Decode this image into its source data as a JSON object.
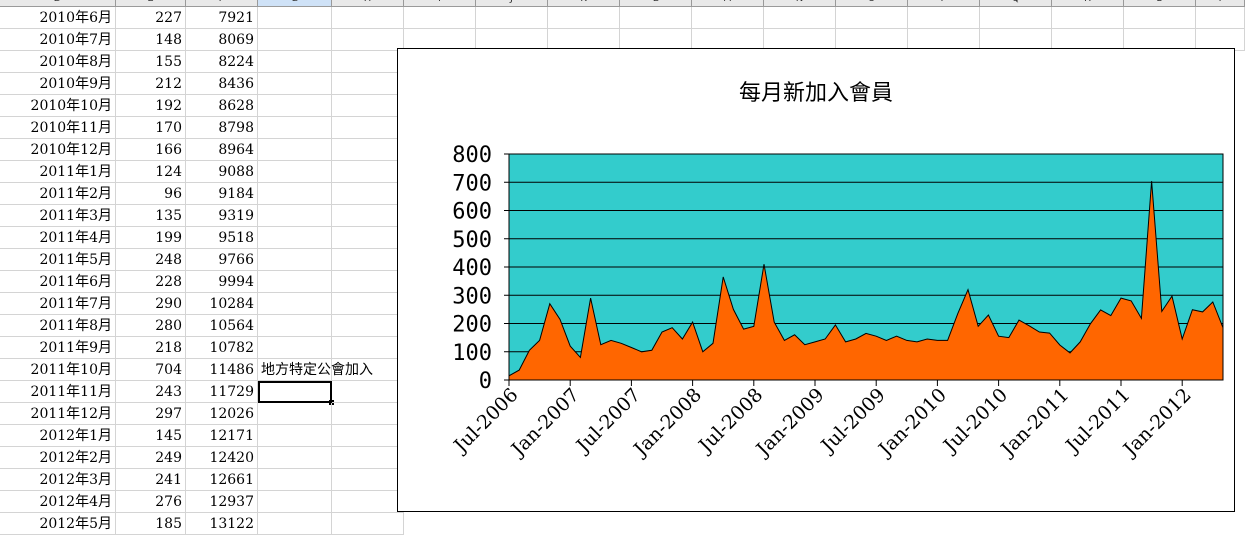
{
  "columns": [
    "D",
    "E",
    "F",
    "G",
    "H",
    "I",
    "J",
    "K",
    "L",
    "M",
    "N",
    "O",
    "P",
    "Q",
    "R",
    "S",
    "T"
  ],
  "rows": [
    {
      "date": "2010年6月",
      "count": "227",
      "total": "7921"
    },
    {
      "date": "2010年7月",
      "count": "148",
      "total": "8069"
    },
    {
      "date": "2010年8月",
      "count": "155",
      "total": "8224"
    },
    {
      "date": "2010年9月",
      "count": "212",
      "total": "8436"
    },
    {
      "date": "2010年10月",
      "count": "192",
      "total": "8628"
    },
    {
      "date": "2010年11月",
      "count": "170",
      "total": "8798"
    },
    {
      "date": "2010年12月",
      "count": "166",
      "total": "8964"
    },
    {
      "date": "2011年1月",
      "count": "124",
      "total": "9088"
    },
    {
      "date": "2011年2月",
      "count": "96",
      "total": "9184"
    },
    {
      "date": "2011年3月",
      "count": "135",
      "total": "9319"
    },
    {
      "date": "2011年4月",
      "count": "199",
      "total": "9518"
    },
    {
      "date": "2011年5月",
      "count": "248",
      "total": "9766"
    },
    {
      "date": "2011年6月",
      "count": "228",
      "total": "9994"
    },
    {
      "date": "2011年7月",
      "count": "290",
      "total": "10284"
    },
    {
      "date": "2011年8月",
      "count": "280",
      "total": "10564"
    },
    {
      "date": "2011年9月",
      "count": "218",
      "total": "10782"
    },
    {
      "date": "2011年10月",
      "count": "704",
      "total": "11486",
      "note": "地方特定公會加入"
    },
    {
      "date": "2011年11月",
      "count": "243",
      "total": "11729"
    },
    {
      "date": "2011年12月",
      "count": "297",
      "total": "12026"
    },
    {
      "date": "2012年1月",
      "count": "145",
      "total": "12171"
    },
    {
      "date": "2012年2月",
      "count": "249",
      "total": "12420"
    },
    {
      "date": "2012年3月",
      "count": "241",
      "total": "12661"
    },
    {
      "date": "2012年4月",
      "count": "276",
      "total": "12937"
    },
    {
      "date": "2012年5月",
      "count": "185",
      "total": "13122"
    }
  ],
  "colors": {
    "plot_bg": "#33cccc",
    "area": "#ff6600",
    "grid": "#000000"
  },
  "chart_data": {
    "type": "area",
    "title": "每月新加入會員",
    "xlabel": "",
    "ylabel": "",
    "ylim": [
      0,
      800
    ],
    "yticks": [
      0,
      100,
      200,
      300,
      400,
      500,
      600,
      700,
      800
    ],
    "xtick_labels": [
      "Jul-2006",
      "Jan-2007",
      "Jul-2007",
      "Jan-2008",
      "Jul-2008",
      "Jan-2009",
      "Jul-2009",
      "Jan-2010",
      "Jul-2010",
      "Jan-2011",
      "Jul-2011",
      "Jan-2012"
    ],
    "grid": true,
    "legend": "none",
    "x": [
      "2006-07",
      "2006-08",
      "2006-09",
      "2006-10",
      "2006-11",
      "2006-12",
      "2007-01",
      "2007-02",
      "2007-03",
      "2007-04",
      "2007-05",
      "2007-06",
      "2007-07",
      "2007-08",
      "2007-09",
      "2007-10",
      "2007-11",
      "2007-12",
      "2008-01",
      "2008-02",
      "2008-03",
      "2008-04",
      "2008-05",
      "2008-06",
      "2008-07",
      "2008-08",
      "2008-09",
      "2008-10",
      "2008-11",
      "2008-12",
      "2009-01",
      "2009-02",
      "2009-03",
      "2009-04",
      "2009-05",
      "2009-06",
      "2009-07",
      "2009-08",
      "2009-09",
      "2009-10",
      "2009-11",
      "2009-12",
      "2010-01",
      "2010-02",
      "2010-03",
      "2010-04",
      "2010-05",
      "2010-06",
      "2010-07",
      "2010-08",
      "2010-09",
      "2010-10",
      "2010-11",
      "2010-12",
      "2011-01",
      "2011-02",
      "2011-03",
      "2011-04",
      "2011-05",
      "2011-06",
      "2011-07",
      "2011-08",
      "2011-09",
      "2011-10",
      "2011-11",
      "2011-12",
      "2012-01",
      "2012-02",
      "2012-03",
      "2012-04",
      "2012-05"
    ],
    "values": [
      15,
      35,
      105,
      140,
      270,
      215,
      120,
      80,
      290,
      125,
      140,
      130,
      115,
      100,
      105,
      170,
      185,
      145,
      205,
      100,
      130,
      365,
      250,
      180,
      190,
      410,
      205,
      140,
      160,
      125,
      135,
      145,
      195,
      135,
      145,
      165,
      155,
      140,
      155,
      140,
      135,
      145,
      140,
      140,
      235,
      320,
      190,
      230,
      155,
      150,
      212,
      192,
      170,
      166,
      124,
      96,
      135,
      199,
      248,
      228,
      290,
      280,
      218,
      704,
      243,
      297,
      145,
      249,
      241,
      276,
      185
    ]
  }
}
